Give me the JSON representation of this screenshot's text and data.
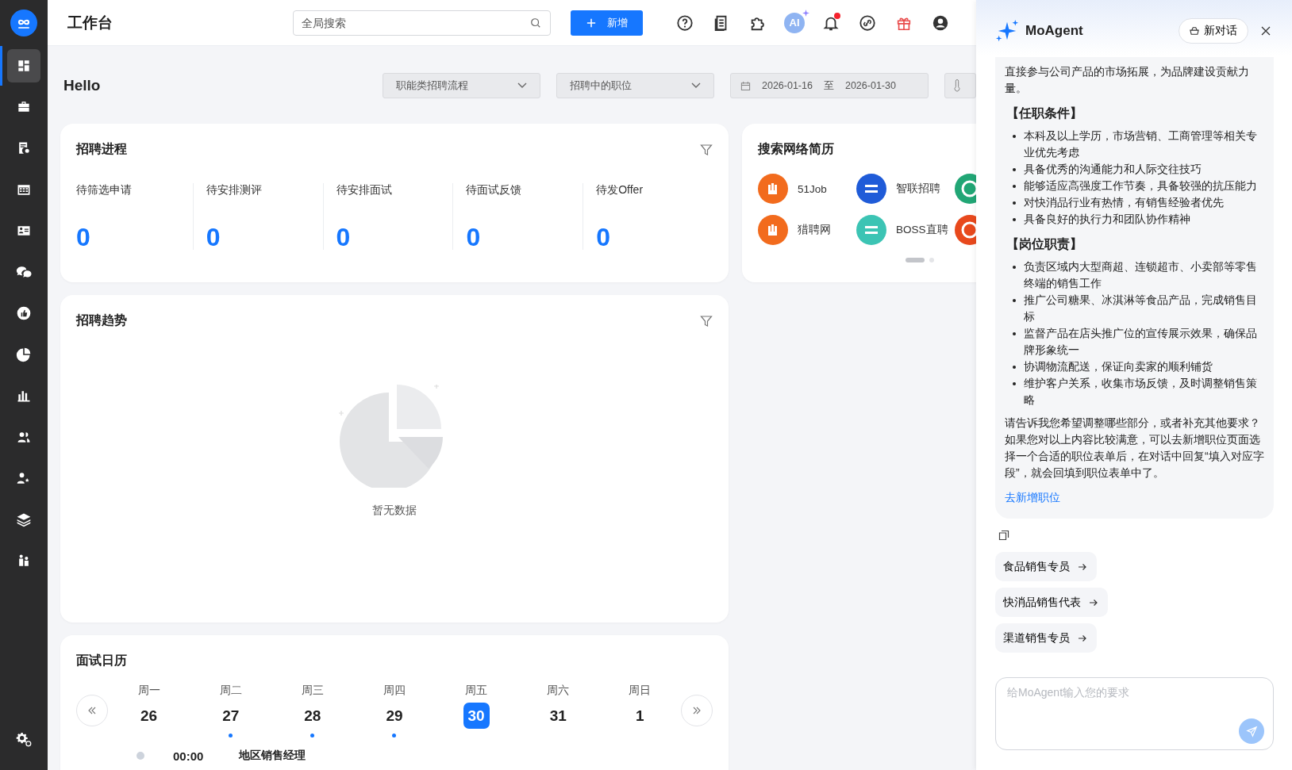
{
  "sidebar": {
    "items": [
      {
        "selected": true
      },
      {
        "selected": false
      },
      {
        "selected": false
      },
      {
        "selected": false
      },
      {
        "selected": false
      },
      {
        "selected": false
      },
      {
        "selected": false
      },
      {
        "selected": false
      },
      {
        "selected": false
      },
      {
        "selected": false
      },
      {
        "selected": false
      },
      {
        "selected": false
      },
      {
        "selected": false
      }
    ]
  },
  "header": {
    "title": "工作台",
    "search": {
      "placeholder": "全局搜索"
    },
    "add_button": "新增",
    "ai_badge": "AI",
    "notifications_unread": true
  },
  "greeting": "Hello",
  "filters": {
    "process": "职能类招聘流程",
    "position": "招聘中的职位",
    "date_start": "2026-01-16",
    "date_sep": "至",
    "date_end": "2026-01-30"
  },
  "progress": {
    "title": "招聘进程",
    "stats": [
      {
        "label": "待筛选申请",
        "value": "0"
      },
      {
        "label": "待安排测评",
        "value": "0"
      },
      {
        "label": "待安排面试",
        "value": "0"
      },
      {
        "label": "待面试反馈",
        "value": "0"
      },
      {
        "label": "待发Offer",
        "value": "0"
      }
    ]
  },
  "resume_search": {
    "title": "搜索网络简历",
    "sites": [
      {
        "name": "51Job",
        "color": "#f26b1d"
      },
      {
        "name": "智联招聘",
        "color": "#1f5bd8"
      },
      {
        "color": "#21a675"
      },
      {
        "name": "猎聘网",
        "color": "#f26b1d"
      },
      {
        "name": "BOSS直聘",
        "color": "#3cc4b4"
      },
      {
        "color": "#e8491d"
      }
    ],
    "pages": [
      {
        "selected": true
      },
      {
        "selected": false
      }
    ]
  },
  "trend": {
    "title": "招聘趋势",
    "empty_text": "暂无数据"
  },
  "calendar": {
    "title": "面试日历",
    "days": [
      {
        "weekday": "周一",
        "date": "26",
        "selected": false,
        "has_interview": false
      },
      {
        "weekday": "周二",
        "date": "27",
        "selected": false,
        "has_interview": true
      },
      {
        "weekday": "周三",
        "date": "28",
        "selected": false,
        "has_interview": true
      },
      {
        "weekday": "周四",
        "date": "29",
        "selected": false,
        "has_interview": true
      },
      {
        "weekday": "周五",
        "date": "30",
        "selected": true,
        "has_interview": false
      },
      {
        "weekday": "周六",
        "date": "31",
        "selected": false,
        "has_interview": false
      },
      {
        "weekday": "周日",
        "date": "1",
        "selected": false,
        "has_interview": false
      }
    ],
    "events": [
      {
        "time": "00:00",
        "title": "地区销售经理"
      }
    ]
  },
  "agent": {
    "title": "MoAgent",
    "new_chat": "新对话",
    "message": [
      {
        "kind": "paragraph",
        "text": "直接参与公司产品的市场拓展，为品牌建设贡献力量。"
      },
      {
        "kind": "heading",
        "text": "【任职条件】"
      },
      {
        "kind": "list",
        "items": [
          "本科及以上学历，市场营销、工商管理等相关专业优先考虑",
          "具备优秀的沟通能力和人际交往技巧",
          "能够适应高强度工作节奏，具备较强的抗压能力",
          "对快消品行业有热情，有销售经验者优先",
          "具备良好的执行力和团队协作精神"
        ]
      },
      {
        "kind": "heading",
        "text": "【岗位职责】"
      },
      {
        "kind": "list",
        "items": [
          "负责区域内大型商超、连锁超市、小卖部等零售终端的销售工作",
          "推广公司糖果、冰淇淋等食品产品，完成销售目标",
          "监督产品在店头推广位的宣传展示效果，确保品牌形象统一",
          "协调物流配送，保证向卖家的顺利铺货",
          "维护客户关系，收集市场反馈，及时调整销售策略"
        ]
      },
      {
        "kind": "paragraph",
        "text": "请告诉我您希望调整哪些部分，或者补充其他要求？如果您对以上内容比较满意，可以去新增职位页面选择一个合适的职位表单后，在对话中回复“填入对应字段”，就会回填到职位表单中了。"
      },
      {
        "kind": "link",
        "text": "去新增职位"
      }
    ],
    "suggestions": [
      "食品销售专员",
      "快消品销售代表",
      "渠道销售专员"
    ],
    "input": {
      "placeholder": "给MoAgent输入您的要求"
    }
  }
}
